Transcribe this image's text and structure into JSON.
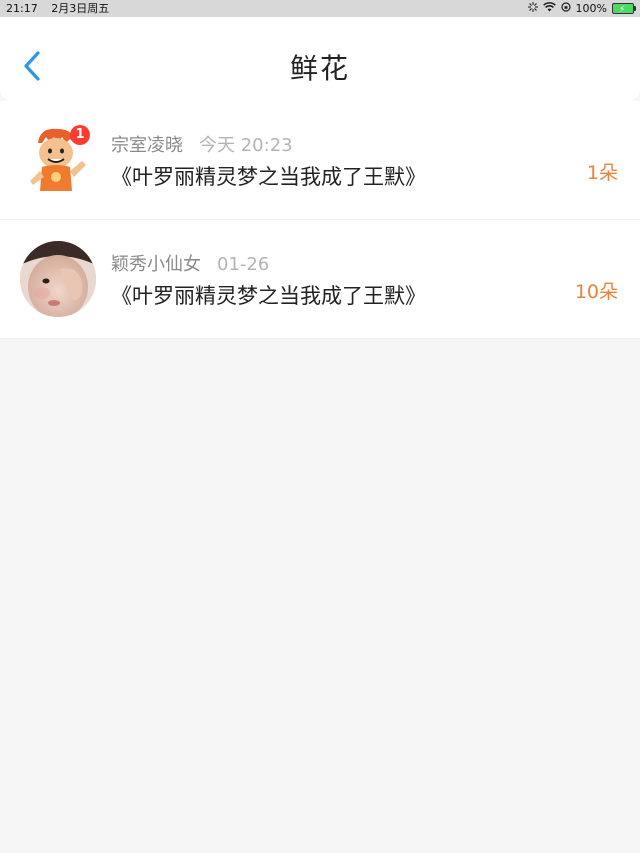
{
  "status_bar": {
    "time": "21:17",
    "date": "2月3日周五",
    "battery": "100%",
    "colors": {
      "battery_fill": "#4cd964"
    }
  },
  "nav": {
    "back_icon": "chevron-left-icon",
    "title": "鲜花",
    "accent_color": "#2a97e8"
  },
  "items": [
    {
      "user": "宗室凌晓",
      "time": "今天 20:23",
      "title": "《叶罗丽精灵梦之当我成了王默》",
      "count": "1朵",
      "badge": "1",
      "avatar": "cartoon-boy-avatar"
    },
    {
      "user": "颖秀小仙女",
      "time": "01-26",
      "title": "《叶罗丽精灵梦之当我成了王默》",
      "count": "10朵",
      "avatar": "child-photo-avatar"
    }
  ],
  "colors": {
    "count": "#e9833c",
    "background": "#f7f6f7"
  }
}
